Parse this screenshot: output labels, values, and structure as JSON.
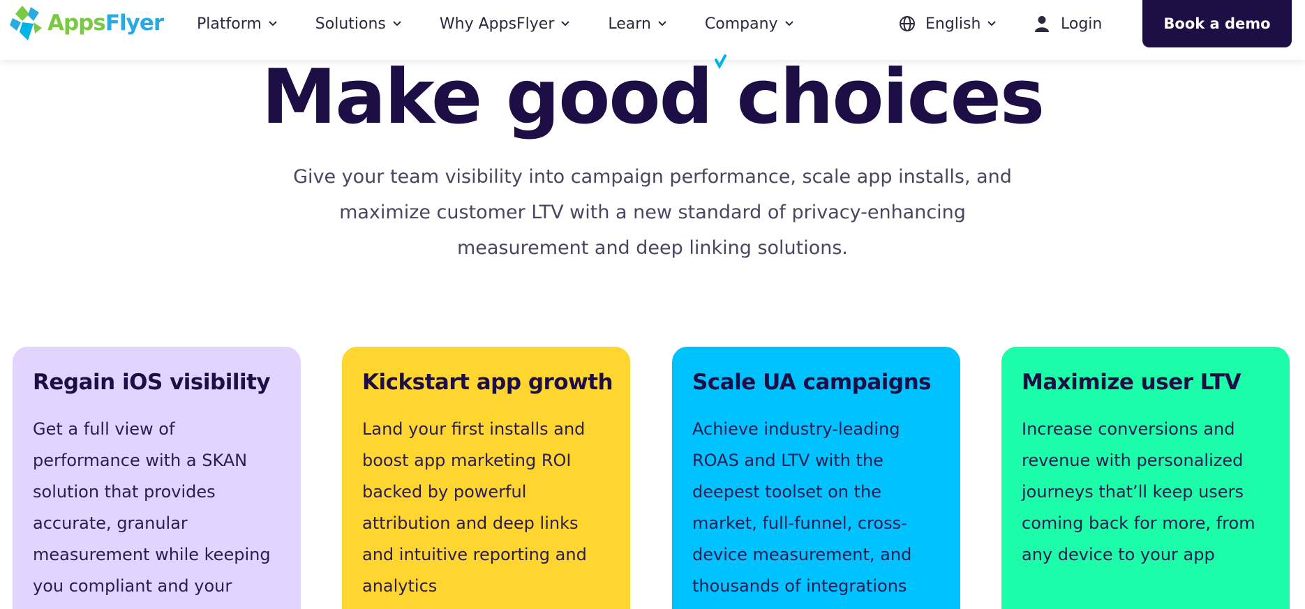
{
  "header": {
    "logo": {
      "part1": "Apps",
      "part2": "Flyer"
    },
    "nav": [
      {
        "label": "Platform"
      },
      {
        "label": "Solutions"
      },
      {
        "label": "Why AppsFlyer"
      },
      {
        "label": "Learn"
      },
      {
        "label": "Company"
      }
    ],
    "language": "English",
    "login": "Login",
    "cta": "Book a demo"
  },
  "hero": {
    "title": "Make good choices",
    "subtitle": "Give your team visibility into campaign performance, scale app installs, and maximize customer LTV with a new standard of privacy-enhancing measurement and deep linking solutions."
  },
  "cards": [
    {
      "title": "Regain iOS visibility",
      "body": "Get a full view of performance with a SKAN solution that provides accurate, granular measurement while keeping you compliant and your",
      "color": "#e2d3ff"
    },
    {
      "title": "Kickstart app growth",
      "body": "Land your first installs and boost app marketing ROI backed by powerful attribution and deep links and intuitive reporting and analytics",
      "color": "#ffd530"
    },
    {
      "title": "Scale UA campaigns",
      "body": "Achieve industry-leading ROAS and LTV with the deepest toolset on the market, full-funnel, cross-device measurement, and thousands of integrations",
      "color": "#00c2ff"
    },
    {
      "title": "Maximize user LTV",
      "body": "Increase conversions and revenue with personalized journeys that’ll keep users coming back for more, from any device to your app",
      "color": "#1dfca8"
    }
  ],
  "colors": {
    "brand_dark": "#1d0f45",
    "logo_green": "#7ac943",
    "logo_blue": "#29abe2"
  },
  "icons": [
    "logo-mark-icon",
    "chevron-down-icon",
    "globe-icon",
    "user-icon"
  ]
}
